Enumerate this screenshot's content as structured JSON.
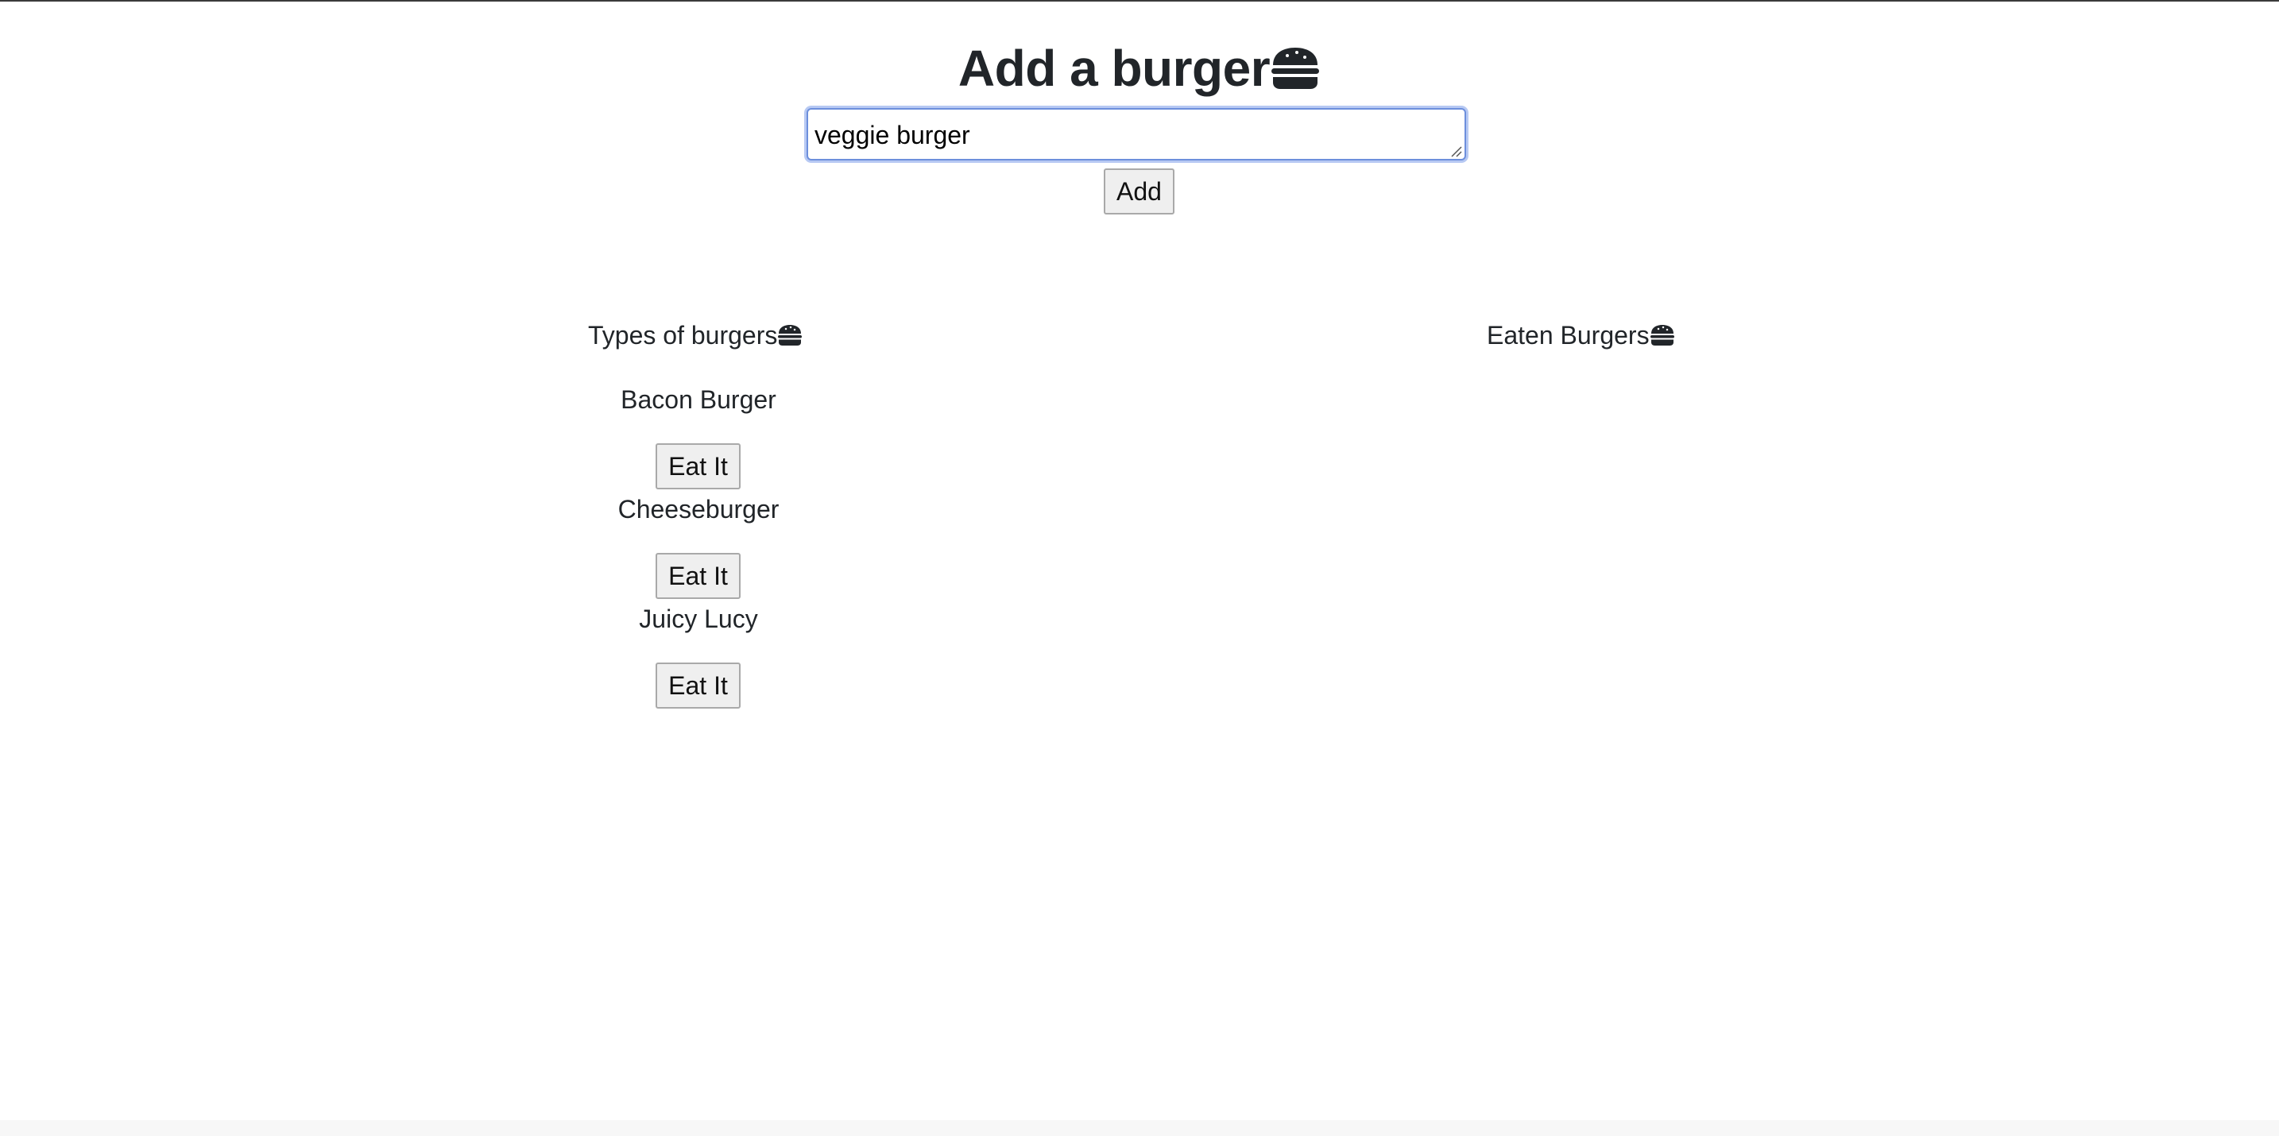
{
  "header": {
    "title": "Add a burger",
    "title_icon": "burger-icon"
  },
  "form": {
    "input_value": "veggie burger",
    "add_label": "Add"
  },
  "uneaten": {
    "heading": "Types of burgers",
    "heading_icon": "burger-icon",
    "items": [
      {
        "name": "Bacon Burger",
        "button": "Eat It"
      },
      {
        "name": "Cheeseburger",
        "button": "Eat It"
      },
      {
        "name": "Juicy Lucy",
        "button": "Eat It"
      }
    ]
  },
  "eaten": {
    "heading": "Eaten Burgers",
    "heading_icon": "burger-icon",
    "items": []
  },
  "colors": {
    "text": "#212529",
    "focus_ring": "#b7c9f3",
    "button_bg": "#efefef"
  }
}
